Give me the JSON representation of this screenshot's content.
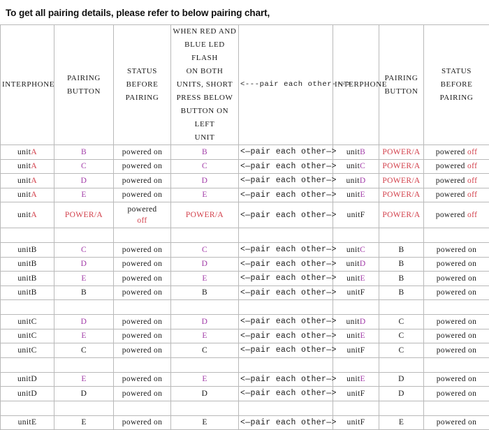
{
  "page": {
    "heading": "To get all pairing details, please refer to below pairing chart,"
  },
  "colors": {
    "red": "#d23f4a",
    "purple": "#a23ca8",
    "black": "#1a1a1a",
    "border": "#b9b9b9"
  },
  "table": {
    "headers": [
      "INTERPHONE",
      "PAIRING BUTTON",
      "STATUS BEFORE PAIRING",
      "WHEN RED AND BLUE LED FLASH ON BOTH UNITS, SHORT PRESS BELOW BUTTON ON LEFT UNIT",
      "<---pair  each other--->",
      "INTERPHONE",
      "PAIRING BUTTON",
      "STATUS BEFORE PAIRING"
    ],
    "header_lines": {
      "h0": [
        "INTERPHONE"
      ],
      "h1": [
        "PAIRING",
        "BUTTON"
      ],
      "h2": [
        "STATUS",
        "BEFORE",
        "PAIRING"
      ],
      "h3": [
        "WHEN RED AND",
        "BLUE LED FLASH",
        "ON BOTH",
        "UNITS,  SHORT",
        "PRESS BELOW",
        "BUTTON ON LEFT",
        "UNIT"
      ],
      "h4": "<---pair  each other--->",
      "h5": [
        "INTERPHONE"
      ],
      "h6": [
        "PAIRING",
        "BUTTON"
      ],
      "h7": [
        "STATUS",
        "BEFORE PAIRING"
      ]
    },
    "arrow_cell": "<—pair each other—>",
    "groups": [
      {
        "name": "group-unitA",
        "rows": [
          {
            "left_unit_prefix": "unit",
            "left_unit_suffix": "A",
            "left_unit_suffix_color": "red",
            "left_button": "B",
            "left_button_color": "purple",
            "left_status_a": "powered on",
            "left_status_b": "",
            "left_status_b_color": "black",
            "press_button": "B",
            "press_button_color": "purple",
            "right_unit_prefix": "unit",
            "right_unit_suffix": "B",
            "right_unit_suffix_color": "purple",
            "right_button": "POWER/A",
            "right_button_color": "red",
            "right_status_a": "powered ",
            "right_status_b": "off",
            "right_status_b_color": "red"
          },
          {
            "left_unit_prefix": "unit",
            "left_unit_suffix": "A",
            "left_unit_suffix_color": "red",
            "left_button": "C",
            "left_button_color": "purple",
            "left_status_a": "powered on",
            "left_status_b": "",
            "left_status_b_color": "black",
            "press_button": "C",
            "press_button_color": "purple",
            "right_unit_prefix": "unit",
            "right_unit_suffix": "C",
            "right_unit_suffix_color": "purple",
            "right_button": "POWER/A",
            "right_button_color": "red",
            "right_status_a": "powered ",
            "right_status_b": "off",
            "right_status_b_color": "red"
          },
          {
            "left_unit_prefix": "unit",
            "left_unit_suffix": "A",
            "left_unit_suffix_color": "red",
            "left_button": "D",
            "left_button_color": "purple",
            "left_status_a": "powered on",
            "left_status_b": "",
            "left_status_b_color": "black",
            "press_button": "D",
            "press_button_color": "purple",
            "right_unit_prefix": "unit",
            "right_unit_suffix": "D",
            "right_unit_suffix_color": "purple",
            "right_button": "POWER/A",
            "right_button_color": "red",
            "right_status_a": "powered ",
            "right_status_b": "off",
            "right_status_b_color": "red"
          },
          {
            "left_unit_prefix": "unit",
            "left_unit_suffix": "A",
            "left_unit_suffix_color": "red",
            "left_button": "E",
            "left_button_color": "purple",
            "left_status_a": "powered on",
            "left_status_b": "",
            "left_status_b_color": "black",
            "press_button": "E",
            "press_button_color": "purple",
            "right_unit_prefix": "unit",
            "right_unit_suffix": "E",
            "right_unit_suffix_color": "purple",
            "right_button": "POWER/A",
            "right_button_color": "red",
            "right_status_a": "powered ",
            "right_status_b": "off",
            "right_status_b_color": "red"
          },
          {
            "tall": true,
            "left_unit_prefix": "unit",
            "left_unit_suffix": "A",
            "left_unit_suffix_color": "red",
            "left_button": "POWER/A",
            "left_button_color": "red",
            "left_status_a": "powered",
            "left_status_b": "off",
            "left_status_b_color": "red",
            "left_status_stacked": true,
            "press_button": "POWER/A",
            "press_button_color": "red",
            "right_unit_prefix": "unit",
            "right_unit_suffix": "F",
            "right_unit_suffix_color": "black",
            "right_button": "POWER/A",
            "right_button_color": "red",
            "right_status_a": "powered ",
            "right_status_b": "off",
            "right_status_b_color": "red"
          }
        ]
      },
      {
        "name": "group-unitB",
        "rows": [
          {
            "left_unit_prefix": "unit",
            "left_unit_suffix": "B",
            "left_unit_suffix_color": "black",
            "left_button": "C",
            "left_button_color": "purple",
            "left_status_a": "powered on",
            "left_status_b": "",
            "left_status_b_color": "black",
            "press_button": "C",
            "press_button_color": "purple",
            "right_unit_prefix": "unit",
            "right_unit_suffix": "C",
            "right_unit_suffix_color": "purple",
            "right_button": "B",
            "right_button_color": "black",
            "right_status_a": "powered on",
            "right_status_b": "",
            "right_status_b_color": "black"
          },
          {
            "left_unit_prefix": "unit",
            "left_unit_suffix": "B",
            "left_unit_suffix_color": "black",
            "left_button": "D",
            "left_button_color": "purple",
            "left_status_a": "powered on",
            "left_status_b": "",
            "left_status_b_color": "black",
            "press_button": "D",
            "press_button_color": "purple",
            "right_unit_prefix": "unit",
            "right_unit_suffix": "D",
            "right_unit_suffix_color": "purple",
            "right_button": "B",
            "right_button_color": "black",
            "right_status_a": "powered on",
            "right_status_b": "",
            "right_status_b_color": "black"
          },
          {
            "left_unit_prefix": "unit",
            "left_unit_suffix": "B",
            "left_unit_suffix_color": "black",
            "left_button": "E",
            "left_button_color": "purple",
            "left_status_a": "powered on",
            "left_status_b": "",
            "left_status_b_color": "black",
            "press_button": "E",
            "press_button_color": "purple",
            "right_unit_prefix": "unit",
            "right_unit_suffix": "E",
            "right_unit_suffix_color": "purple",
            "right_button": "B",
            "right_button_color": "black",
            "right_status_a": "powered on",
            "right_status_b": "",
            "right_status_b_color": "black"
          },
          {
            "left_unit_prefix": "unit",
            "left_unit_suffix": "B",
            "left_unit_suffix_color": "black",
            "left_button": "B",
            "left_button_color": "black",
            "left_status_a": "powered on",
            "left_status_b": "",
            "left_status_b_color": "black",
            "press_button": "B",
            "press_button_color": "black",
            "right_unit_prefix": "unit",
            "right_unit_suffix": "F",
            "right_unit_suffix_color": "black",
            "right_button": "B",
            "right_button_color": "black",
            "right_status_a": "powered on",
            "right_status_b": "",
            "right_status_b_color": "black"
          }
        ]
      },
      {
        "name": "group-unitC",
        "rows": [
          {
            "left_unit_prefix": "unit",
            "left_unit_suffix": "C",
            "left_unit_suffix_color": "black",
            "left_button": "D",
            "left_button_color": "purple",
            "left_status_a": "powered on",
            "left_status_b": "",
            "left_status_b_color": "black",
            "press_button": "D",
            "press_button_color": "purple",
            "right_unit_prefix": "unit",
            "right_unit_suffix": "D",
            "right_unit_suffix_color": "purple",
            "right_button": "C",
            "right_button_color": "black",
            "right_status_a": "powered on",
            "right_status_b": "",
            "right_status_b_color": "black"
          },
          {
            "left_unit_prefix": "unit",
            "left_unit_suffix": "C",
            "left_unit_suffix_color": "black",
            "left_button": "E",
            "left_button_color": "purple",
            "left_status_a": "powered on",
            "left_status_b": "",
            "left_status_b_color": "black",
            "press_button": "E",
            "press_button_color": "purple",
            "right_unit_prefix": "unit",
            "right_unit_suffix": "E",
            "right_unit_suffix_color": "purple",
            "right_button": "C",
            "right_button_color": "black",
            "right_status_a": "powered on",
            "right_status_b": "",
            "right_status_b_color": "black"
          },
          {
            "left_unit_prefix": "unit",
            "left_unit_suffix": "C",
            "left_unit_suffix_color": "black",
            "left_button": "C",
            "left_button_color": "black",
            "left_status_a": "powered on",
            "left_status_b": "",
            "left_status_b_color": "black",
            "press_button": "C",
            "press_button_color": "black",
            "right_unit_prefix": "unit",
            "right_unit_suffix": "F",
            "right_unit_suffix_color": "black",
            "right_button": "C",
            "right_button_color": "black",
            "right_status_a": "powered on",
            "right_status_b": "",
            "right_status_b_color": "black"
          }
        ]
      },
      {
        "name": "group-unitD",
        "rows": [
          {
            "left_unit_prefix": "unit",
            "left_unit_suffix": "D",
            "left_unit_suffix_color": "black",
            "left_button": "E",
            "left_button_color": "purple",
            "left_status_a": "powered on",
            "left_status_b": "",
            "left_status_b_color": "black",
            "press_button": "E",
            "press_button_color": "purple",
            "right_unit_prefix": "unit",
            "right_unit_suffix": "E",
            "right_unit_suffix_color": "purple",
            "right_button": "D",
            "right_button_color": "black",
            "right_status_a": "powered on",
            "right_status_b": "",
            "right_status_b_color": "black"
          },
          {
            "left_unit_prefix": "unit",
            "left_unit_suffix": "D",
            "left_unit_suffix_color": "black",
            "left_button": "D",
            "left_button_color": "black",
            "left_status_a": "powered on",
            "left_status_b": "",
            "left_status_b_color": "black",
            "press_button": "D",
            "press_button_color": "black",
            "right_unit_prefix": "unit",
            "right_unit_suffix": "F",
            "right_unit_suffix_color": "black",
            "right_button": "D",
            "right_button_color": "black",
            "right_status_a": "powered on",
            "right_status_b": "",
            "right_status_b_color": "black"
          }
        ]
      },
      {
        "name": "group-unitE",
        "rows": [
          {
            "left_unit_prefix": "unit",
            "left_unit_suffix": "E",
            "left_unit_suffix_color": "black",
            "left_button": "E",
            "left_button_color": "black",
            "left_status_a": "powered on",
            "left_status_b": "",
            "left_status_b_color": "black",
            "press_button": "E",
            "press_button_color": "black",
            "right_unit_prefix": "unit",
            "right_unit_suffix": "F",
            "right_unit_suffix_color": "black",
            "right_button": "E",
            "right_button_color": "black",
            "right_status_a": "powered on",
            "right_status_b": "",
            "right_status_b_color": "black"
          }
        ]
      }
    ]
  }
}
